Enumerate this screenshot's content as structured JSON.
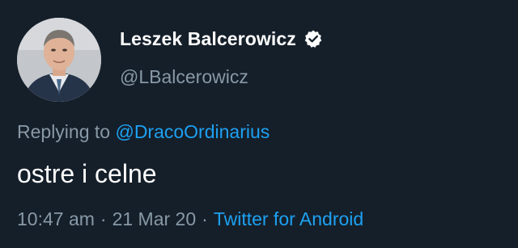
{
  "colors": {
    "background": "#151f2a",
    "primary_text": "#ffffff",
    "secondary_text": "#8899a6",
    "accent": "#1da1f2"
  },
  "author": {
    "display_name": "Leszek Balcerowicz",
    "handle": "@LBalcerowicz",
    "avatar_icon": "profile-photo",
    "verified_icon": "verified-badge-icon"
  },
  "reply": {
    "prefix": "Replying to",
    "mention": "@DracoOrdinarius"
  },
  "tweet": {
    "text": "ostre i celne"
  },
  "meta": {
    "time": "10:47 am",
    "separator_1": "·",
    "date": "21 Mar 20",
    "separator_2": "·",
    "source": "Twitter for Android"
  }
}
